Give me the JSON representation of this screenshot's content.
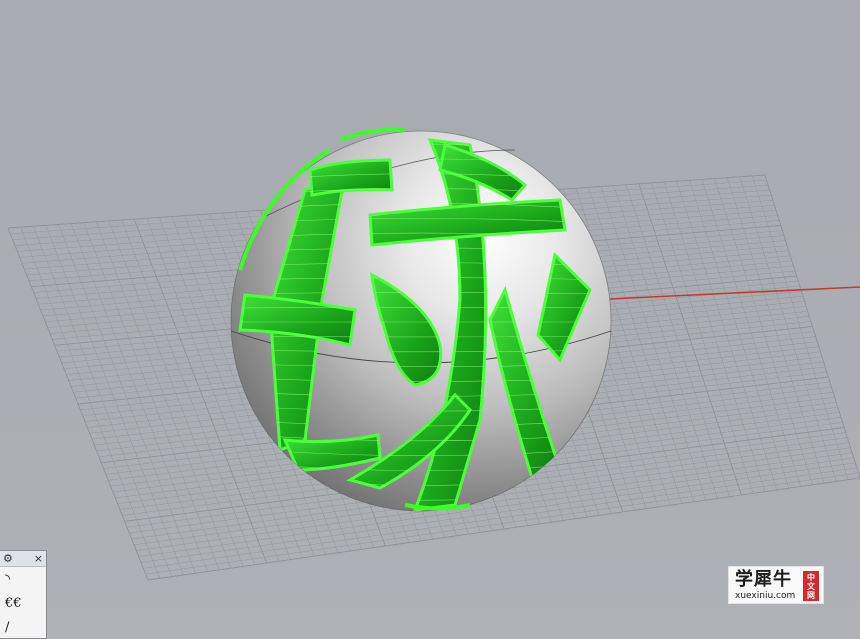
{
  "viewport": {
    "name": "perspective-viewport",
    "background_color": "#aaadb3",
    "grid_color": "#8e9196",
    "x_axis_color": "#c0392b",
    "object": {
      "type": "sphere-with-extruded-text",
      "sphere_color": "#d8d8d8",
      "selection_color": "#22ee22",
      "highlight_color": "#7dff5a",
      "text_glyphs": "球"
    }
  },
  "tool_panel": {
    "settings_icon": "⚙",
    "close_icon": "×",
    "tools": [
      {
        "icon": "arc-curve-icon",
        "glyph": "◝"
      },
      {
        "icon": "double-curve-icon",
        "glyph": "€€"
      },
      {
        "icon": "line-icon",
        "glyph": "/"
      }
    ]
  },
  "watermark": {
    "main_text": "学犀牛",
    "url": "xuexiniu.com",
    "seal_chars": [
      "中",
      "文",
      "网"
    ]
  }
}
